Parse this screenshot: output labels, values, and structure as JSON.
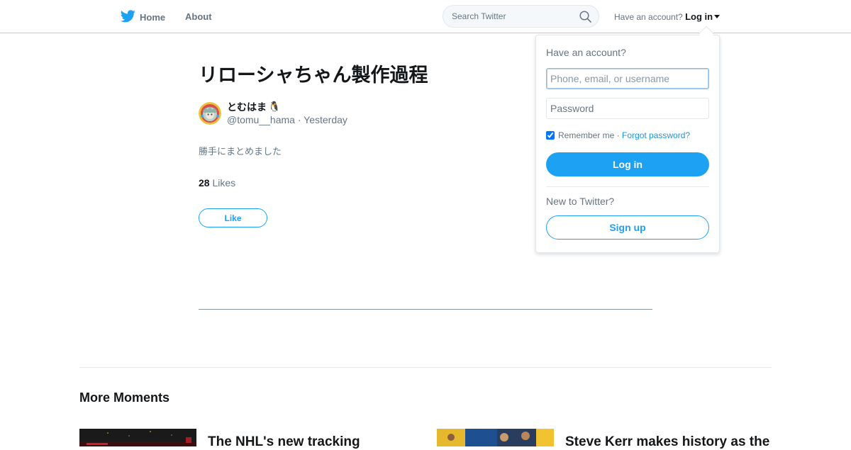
{
  "nav": {
    "home_label": "Home",
    "about_label": "About"
  },
  "search": {
    "placeholder": "Search Twitter"
  },
  "account": {
    "prompt": "Have an account?",
    "login_label": "Log in"
  },
  "moment": {
    "title": "リローシャちゃん製作過程",
    "author_name": "とむはま",
    "author_emoji": "🐧",
    "handle": "@tomu__hama",
    "separator": " · ",
    "time": "Yesterday",
    "description": "勝手にまとめました",
    "likes_count": "28",
    "likes_label": " Likes",
    "like_button": "Like"
  },
  "more_moments": {
    "heading": "More Moments",
    "cards": [
      {
        "title": "The NHL's new tracking"
      },
      {
        "title": "Steve Kerr makes history as the"
      }
    ]
  },
  "login_dropdown": {
    "heading": "Have an account?",
    "username_placeholder": "Phone, email, or username",
    "password_placeholder": "Password",
    "remember_label": "Remember me",
    "separator": " · ",
    "forgot_label": "Forgot password?",
    "login_button": "Log in",
    "new_prompt": "New to Twitter?",
    "signup_button": "Sign up"
  },
  "colors": {
    "brand_blue": "#1da1f2",
    "link_blue": "#1b95e0",
    "muted_text": "#657786"
  }
}
